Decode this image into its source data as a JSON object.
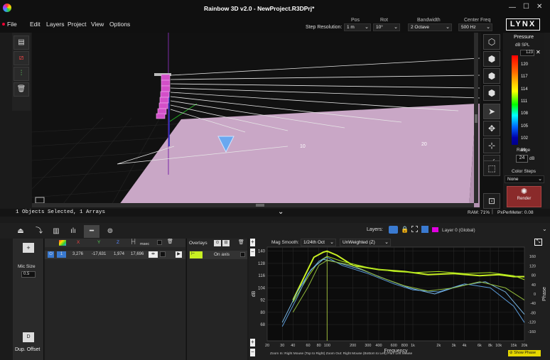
{
  "window": {
    "title": "Rainbow 3D v2.0  -  NewProject.R3DPrj*",
    "controls": [
      "—",
      "☐",
      "✕"
    ]
  },
  "menu": [
    "File",
    "Edit",
    "Layers",
    "Project",
    "View",
    "Options"
  ],
  "toolbar": {
    "step_resolution_label": "Step Resolution:",
    "pos_label": "Pos",
    "pos_value": "1 m",
    "rot_label": "Rot",
    "rot_value": "10°",
    "bandwidth_label": "Bandwidth",
    "bandwidth_value": "2 Octave",
    "center_freq_label": "Center Freq",
    "center_freq_value": "500 Hz",
    "logo": "LYNX"
  },
  "legend": {
    "title": "Pressure",
    "unit": "dB SPL",
    "max_value": "123",
    "ticks": [
      "120",
      "117",
      "114",
      "111",
      "108",
      "105",
      "102",
      "99"
    ],
    "range_label": "Range",
    "range_value": "24",
    "range_unit": "dB",
    "color_steps_label": "Color Steps",
    "color_steps_value": "None",
    "render_label": "Render"
  },
  "viewport": {
    "distance_labels": [
      "10",
      "20"
    ]
  },
  "statusbar": {
    "left": "1 Objects Selected, 1 Arrays",
    "ram": "RAM: 71%",
    "px_per_meter": "PxPerMeter: 0.08"
  },
  "bottom_toolbar": {
    "layers_label": "Layers:",
    "layer_name": "Layer 0 (Global)"
  },
  "mic_panel": {
    "mic_size_label": "Mic Size",
    "mic_size_value": "0.5",
    "dup_offset_label": "Dup. Offset"
  },
  "table": {
    "headers": [
      "X",
      "Y",
      "Z"
    ],
    "msec_label": "msec",
    "row": {
      "index": "1",
      "x": "3,276",
      "y": "-17,631",
      "z": "1,974",
      "msec": "17,696"
    }
  },
  "overlays": {
    "label": "Overlays",
    "item": "On axis"
  },
  "chart_panel": {
    "mag_smooth_label": "Mag Smooth:",
    "mag_smooth_value": "1/24th Oct",
    "weighting_value": "UnWeighted (Z)",
    "footer": "Zoom In: Right Mouse (Top to Right)    Zoom Out: Right Mouse (Bottom to Left)    Pan: Left Mouse",
    "show_phase_label": "Show Phase"
  },
  "chart_data": {
    "type": "line",
    "xlabel": "Frequency",
    "ylabel": "dB",
    "y2label": "Phase",
    "xscale": "log",
    "xlim": [
      20,
      20000
    ],
    "ylim": [
      52,
      144
    ],
    "y2lim": [
      -200,
      200
    ],
    "x_tick_labels": [
      "20",
      "30",
      "40",
      "60",
      "80",
      "100",
      "200",
      "300",
      "400",
      "600",
      "800",
      "1k",
      "2k",
      "3k",
      "4k",
      "6k",
      "8k",
      "10k",
      "15k",
      "20k"
    ],
    "y_ticks": [
      140,
      128,
      116,
      104,
      92,
      80,
      68
    ],
    "y2_ticks": [
      160,
      120,
      80,
      40,
      0,
      -40,
      -80,
      -120,
      -160
    ],
    "grid": true,
    "series": [
      {
        "color": "#c8f022",
        "values": [
          [
            40,
            92
          ],
          [
            55,
            116
          ],
          [
            70,
            134
          ],
          [
            90,
            139
          ],
          [
            100,
            140
          ],
          [
            130,
            136
          ],
          [
            200,
            126
          ],
          [
            400,
            122
          ],
          [
            800,
            120
          ],
          [
            1500,
            117
          ],
          [
            3000,
            118
          ],
          [
            6000,
            116
          ],
          [
            10000,
            117
          ],
          [
            15000,
            115
          ],
          [
            20000,
            115
          ]
        ]
      },
      {
        "color": "#a6e01e",
        "values": [
          [
            40,
            90
          ],
          [
            60,
            115
          ],
          [
            80,
            130
          ],
          [
            100,
            135
          ],
          [
            150,
            130
          ],
          [
            300,
            124
          ],
          [
            600,
            120
          ],
          [
            1000,
            119
          ],
          [
            2000,
            120
          ],
          [
            4000,
            118
          ],
          [
            8000,
            119
          ],
          [
            15000,
            116
          ],
          [
            20000,
            112
          ]
        ]
      },
      {
        "color": "#5a9ad8",
        "values": [
          [
            30,
            66
          ],
          [
            45,
            95
          ],
          [
            60,
            118
          ],
          [
            80,
            130
          ],
          [
            100,
            134
          ],
          [
            150,
            126
          ],
          [
            300,
            118
          ],
          [
            600,
            108
          ],
          [
            1000,
            102
          ],
          [
            2000,
            100
          ],
          [
            4000,
            108
          ],
          [
            8000,
            104
          ],
          [
            15000,
            86
          ],
          [
            20000,
            70
          ]
        ]
      },
      {
        "color": "#7ab8e6",
        "values": [
          [
            30,
            70
          ],
          [
            45,
            100
          ],
          [
            65,
            122
          ],
          [
            90,
            132
          ],
          [
            120,
            130
          ],
          [
            250,
            122
          ],
          [
            500,
            112
          ],
          [
            900,
            104
          ],
          [
            1800,
            98
          ],
          [
            3500,
            106
          ],
          [
            7000,
            110
          ],
          [
            12000,
            100
          ],
          [
            20000,
            78
          ]
        ]
      },
      {
        "color": "#8fb83a",
        "values": [
          [
            40,
            80
          ],
          [
            60,
            105
          ],
          [
            80,
            126
          ],
          [
            100,
            131
          ],
          [
            200,
            126
          ],
          [
            400,
            115
          ],
          [
            800,
            106
          ],
          [
            1500,
            101
          ],
          [
            3000,
            104
          ],
          [
            6000,
            110
          ],
          [
            12000,
            104
          ],
          [
            20000,
            92
          ]
        ]
      }
    ]
  }
}
